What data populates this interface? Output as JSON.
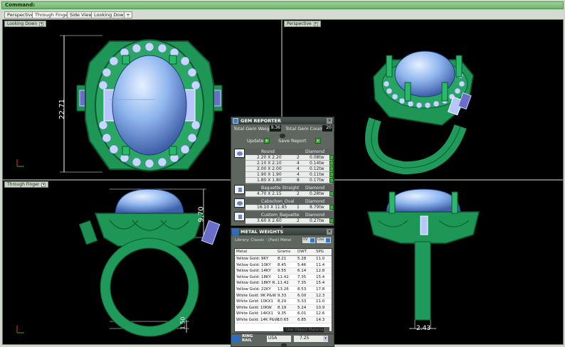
{
  "command": {
    "label": "Command:"
  },
  "tabs": [
    {
      "label": "Perspective"
    },
    {
      "label": "Through Finger"
    },
    {
      "label": "Side View"
    },
    {
      "label": "Looking Down"
    },
    {
      "label": "+"
    }
  ],
  "viewports": {
    "top_left": {
      "label": "Looking Down",
      "dimension": "22.71"
    },
    "top_right": {
      "label": "Perspective"
    },
    "bottom_left": {
      "label": "Through Finger",
      "dimension_height": "9.70",
      "dimension_small": "1.50"
    },
    "bottom_right": {
      "dimension": "2.43"
    }
  },
  "gem_reporter": {
    "title": "GEM REPORTER",
    "total_gem_weight_label": "Total Gem Weight",
    "total_gem_weight": "9.36",
    "total_gem_count_label": "Total Gem Count",
    "total_gem_count": "20",
    "update_label": "Update",
    "save_report_label": "Save Report",
    "groups": [
      {
        "shape": "Round",
        "material": "Diamond",
        "rows": [
          {
            "size": "2.20 X 2.20",
            "count": "2",
            "weight": "0.08tw"
          },
          {
            "size": "2.10 X 2.10",
            "count": "4",
            "weight": "0.14tw"
          },
          {
            "size": "2.00 X 2.00",
            "count": "4",
            "weight": "0.12tw"
          },
          {
            "size": "1.90 X 1.90",
            "count": "4",
            "weight": "0.11tw"
          },
          {
            "size": "1.80 X 1.80",
            "count": "8",
            "weight": "0.17tw"
          }
        ]
      },
      {
        "shape": "Baguette Straight",
        "material": "Diamond",
        "rows": [
          {
            "size": "4.70 X 2.15",
            "count": "2",
            "weight": "0.28tw"
          }
        ]
      },
      {
        "shape": "Cabochon_Oval",
        "material": "Diamond",
        "rows": [
          {
            "size": "16.10 X 11.85",
            "count": "1",
            "weight": "8.79tw"
          }
        ]
      },
      {
        "shape": "Custom_Baguette",
        "material": "Diamond",
        "rows": [
          {
            "size": "3.60 X 2.60",
            "count": "2",
            "weight": "0.27tw"
          }
        ]
      }
    ]
  },
  "metal_weights": {
    "title": "METAL WEIGHTS",
    "library": "Library: Classic - (Fast) Metal",
    "btn1": "0V",
    "btn2": "Use",
    "columns": [
      "Metal",
      "Grams",
      "DWT",
      "SPG"
    ],
    "rows": [
      [
        "Yellow Gold: 9KY",
        "8.21",
        "5.28",
        "11.0"
      ],
      [
        "Yellow Gold: 10KY",
        "8.45",
        "5.46",
        "11.4"
      ],
      [
        "Yellow Gold: 14KY",
        "9.55",
        "6.14",
        "12.8"
      ],
      [
        "Yellow Gold: 18KY",
        "11.42",
        "7.35",
        "15.4"
      ],
      [
        "Yellow Gold: 18KY R...",
        "11.42",
        "7.35",
        "15.4"
      ],
      [
        "Yellow Gold: 22KY",
        "13.26",
        "8.53",
        "17.8"
      ],
      [
        "White Gold: 9K P&W",
        "9.33",
        "6.00",
        "12.3"
      ],
      [
        "White Gold: 10KX1",
        "8.29",
        "5.33",
        "11.0"
      ],
      [
        "White Gold: 10KW",
        "8.19",
        "5.24",
        "10.9"
      ],
      [
        "White Gold: 14KX1",
        "9.35",
        "6.01",
        "12.6"
      ],
      [
        "White Gold: 14K P&W",
        "10.65",
        "6.85",
        "14.3"
      ]
    ]
  },
  "ring_rail": {
    "title_line1": "RING",
    "title_line2": "RAIL",
    "standard": "USA",
    "size": "7.25"
  },
  "use_object_material": "Use Object Material",
  "colors": {
    "metal_green": "#1f9a5a",
    "gem_blue": "#8fb6ef",
    "viewport_bg": "#000000"
  }
}
